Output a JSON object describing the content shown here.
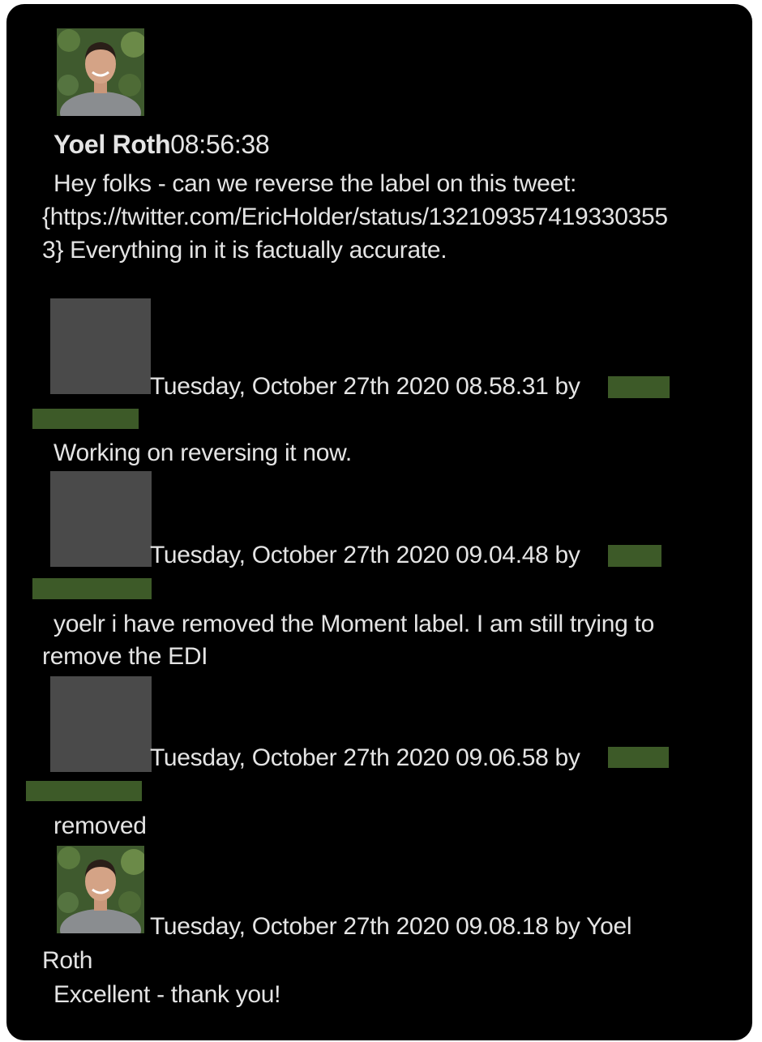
{
  "messages": [
    {
      "sender": "Yoel Roth",
      "time": "08:56:38",
      "lines": [
        "Hey folks - can we reverse the label on this tweet:",
        "{https://twitter.com/EricHolder/status/132109357419330355",
        "3} Everything in it is factually accurate."
      ]
    },
    {
      "meta": "Tuesday, October 27th 2020 08.58.31 by",
      "lines": [
        "Working on reversing it now."
      ]
    },
    {
      "meta": "Tuesday, October 27th 2020 09.04.48 by",
      "lines": [
        "yoelr i have removed the Moment label. I am still trying to",
        "remove the EDI"
      ]
    },
    {
      "meta": "Tuesday, October 27th 2020 09.06.58 by",
      "lines": [
        "removed"
      ]
    },
    {
      "meta": "Tuesday, October 27th 2020 09.08.18 by Yoel",
      "meta_cont": "Roth",
      "lines": [
        "Excellent - thank you!"
      ]
    }
  ],
  "colors": {
    "background": "#000000",
    "text": "#e4e4e4",
    "redaction_box": "#4a4a4a",
    "redaction_name": "#3d5a28"
  },
  "icons": {
    "avatar": "profile-photo-avatar"
  }
}
